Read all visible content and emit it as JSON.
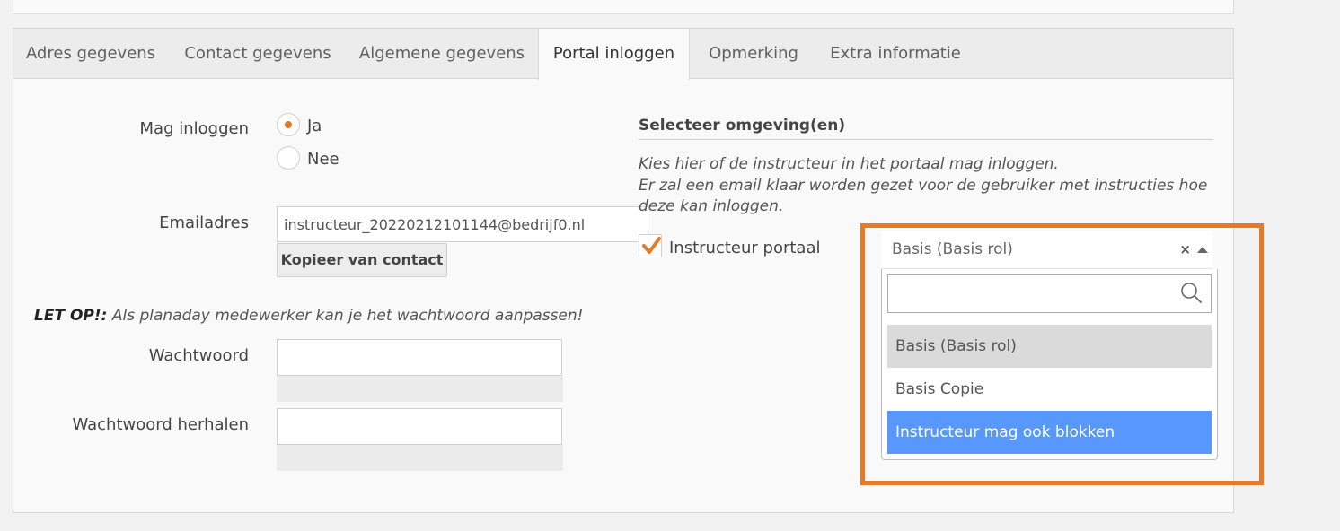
{
  "tabs": [
    {
      "label": "Adres gegevens"
    },
    {
      "label": "Contact gegevens"
    },
    {
      "label": "Algemene gegevens"
    },
    {
      "label": "Portal inloggen"
    },
    {
      "label": "Opmerking"
    },
    {
      "label": "Extra informatie"
    }
  ],
  "active_tab": "Portal inloggen",
  "login": {
    "label": "Mag inloggen",
    "option_yes": "Ja",
    "option_no": "Nee",
    "selected": "Ja"
  },
  "email": {
    "label": "Emailadres",
    "value": "instructeur_20220212101144@bedrijf0.nl",
    "copy_button": "Kopieer van contact"
  },
  "notice": {
    "prefix": "LET OP!:",
    "text": " Als planaday medewerker kan je het wachtwoord aanpassen!"
  },
  "password": {
    "label": "Wachtwoord",
    "repeat_label": "Wachtwoord herhalen"
  },
  "environment": {
    "title": "Selecteer omgeving(en)",
    "description_1": "Kies hier of de instructeur in het portaal mag inloggen.",
    "description_2": "Er zal een email klaar worden gezet voor de gebruiker met instructies hoe",
    "description_3": "deze kan inloggen.",
    "checkbox_label": "Instructeur portaal",
    "checkbox_checked": true
  },
  "role_select": {
    "selected": "Basis (Basis rol)",
    "clear_symbol": "×",
    "search_value": "",
    "options": [
      {
        "label": "Basis (Basis rol)"
      },
      {
        "label": "Basis Copie"
      },
      {
        "label": "Instructeur mag ook blokken"
      }
    ]
  },
  "colors": {
    "accent": "#e57b26",
    "option_highlight": "#5897fb"
  }
}
